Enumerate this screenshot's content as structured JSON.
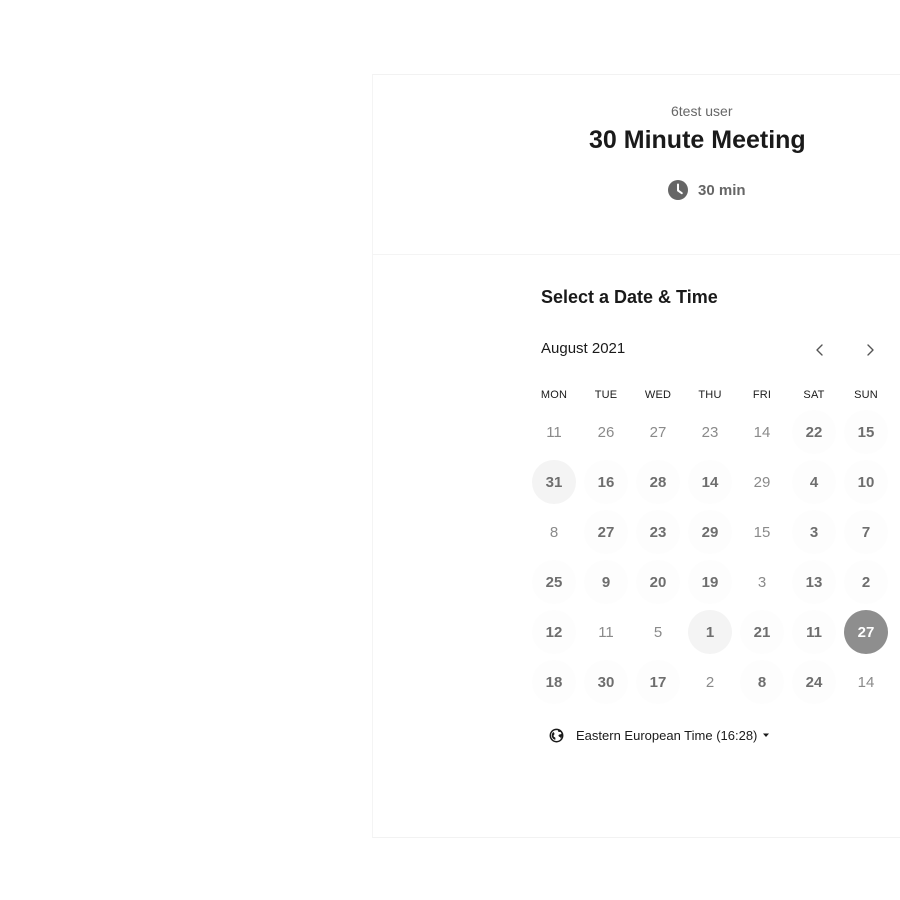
{
  "header": {
    "host_name": "6test user",
    "event_title": "30 Minute Meeting",
    "duration": "30 min",
    "duration_icon": "clock-icon"
  },
  "calendar": {
    "section_title": "Select a Date & Time",
    "month_label": "August 2021",
    "prev_icon": "chevron-left-icon",
    "next_icon": "chevron-right-icon",
    "weekdays": [
      "MON",
      "TUE",
      "WED",
      "THU",
      "FRI",
      "SAT",
      "SUN"
    ],
    "weeks": [
      [
        {
          "label": "11",
          "state": "unavailable"
        },
        {
          "label": "26",
          "state": "unavailable"
        },
        {
          "label": "27",
          "state": "unavailable"
        },
        {
          "label": "23",
          "state": "unavailable"
        },
        {
          "label": "14",
          "state": "unavailable"
        },
        {
          "label": "22",
          "state": "available"
        },
        {
          "label": "15",
          "state": "available"
        }
      ],
      [
        {
          "label": "31",
          "state": "today"
        },
        {
          "label": "16",
          "state": "available"
        },
        {
          "label": "28",
          "state": "available"
        },
        {
          "label": "14",
          "state": "available"
        },
        {
          "label": "29",
          "state": "unavailable"
        },
        {
          "label": "4",
          "state": "available"
        },
        {
          "label": "10",
          "state": "available"
        }
      ],
      [
        {
          "label": "8",
          "state": "unavailable"
        },
        {
          "label": "27",
          "state": "available"
        },
        {
          "label": "23",
          "state": "available"
        },
        {
          "label": "29",
          "state": "available"
        },
        {
          "label": "15",
          "state": "unavailable"
        },
        {
          "label": "3",
          "state": "available"
        },
        {
          "label": "7",
          "state": "available"
        }
      ],
      [
        {
          "label": "25",
          "state": "available"
        },
        {
          "label": "9",
          "state": "available"
        },
        {
          "label": "20",
          "state": "available"
        },
        {
          "label": "19",
          "state": "available"
        },
        {
          "label": "3",
          "state": "unavailable"
        },
        {
          "label": "13",
          "state": "available"
        },
        {
          "label": "2",
          "state": "available"
        }
      ],
      [
        {
          "label": "12",
          "state": "available"
        },
        {
          "label": "11",
          "state": "unavailable"
        },
        {
          "label": "5",
          "state": "unavailable"
        },
        {
          "label": "1",
          "state": "today"
        },
        {
          "label": "21",
          "state": "available"
        },
        {
          "label": "11",
          "state": "available"
        },
        {
          "label": "27",
          "state": "selected"
        }
      ],
      [
        {
          "label": "18",
          "state": "available"
        },
        {
          "label": "30",
          "state": "available"
        },
        {
          "label": "17",
          "state": "available"
        },
        {
          "label": "2",
          "state": "unavailable"
        },
        {
          "label": "8",
          "state": "available"
        },
        {
          "label": "24",
          "state": "available"
        },
        {
          "label": "14",
          "state": "unavailable"
        }
      ]
    ]
  },
  "timezone": {
    "label": "Eastern European Time (16:28)",
    "icon": "globe-icon",
    "caret_icon": "caret-down-icon"
  },
  "colors": {
    "text_primary": "#1a1a1a",
    "text_muted": "#666666",
    "day_available": "#6e6e6e",
    "day_unavailable": "#8a8a8a",
    "selected_bg": "#8e8e8e",
    "today_bg": "#f4f4f4"
  }
}
